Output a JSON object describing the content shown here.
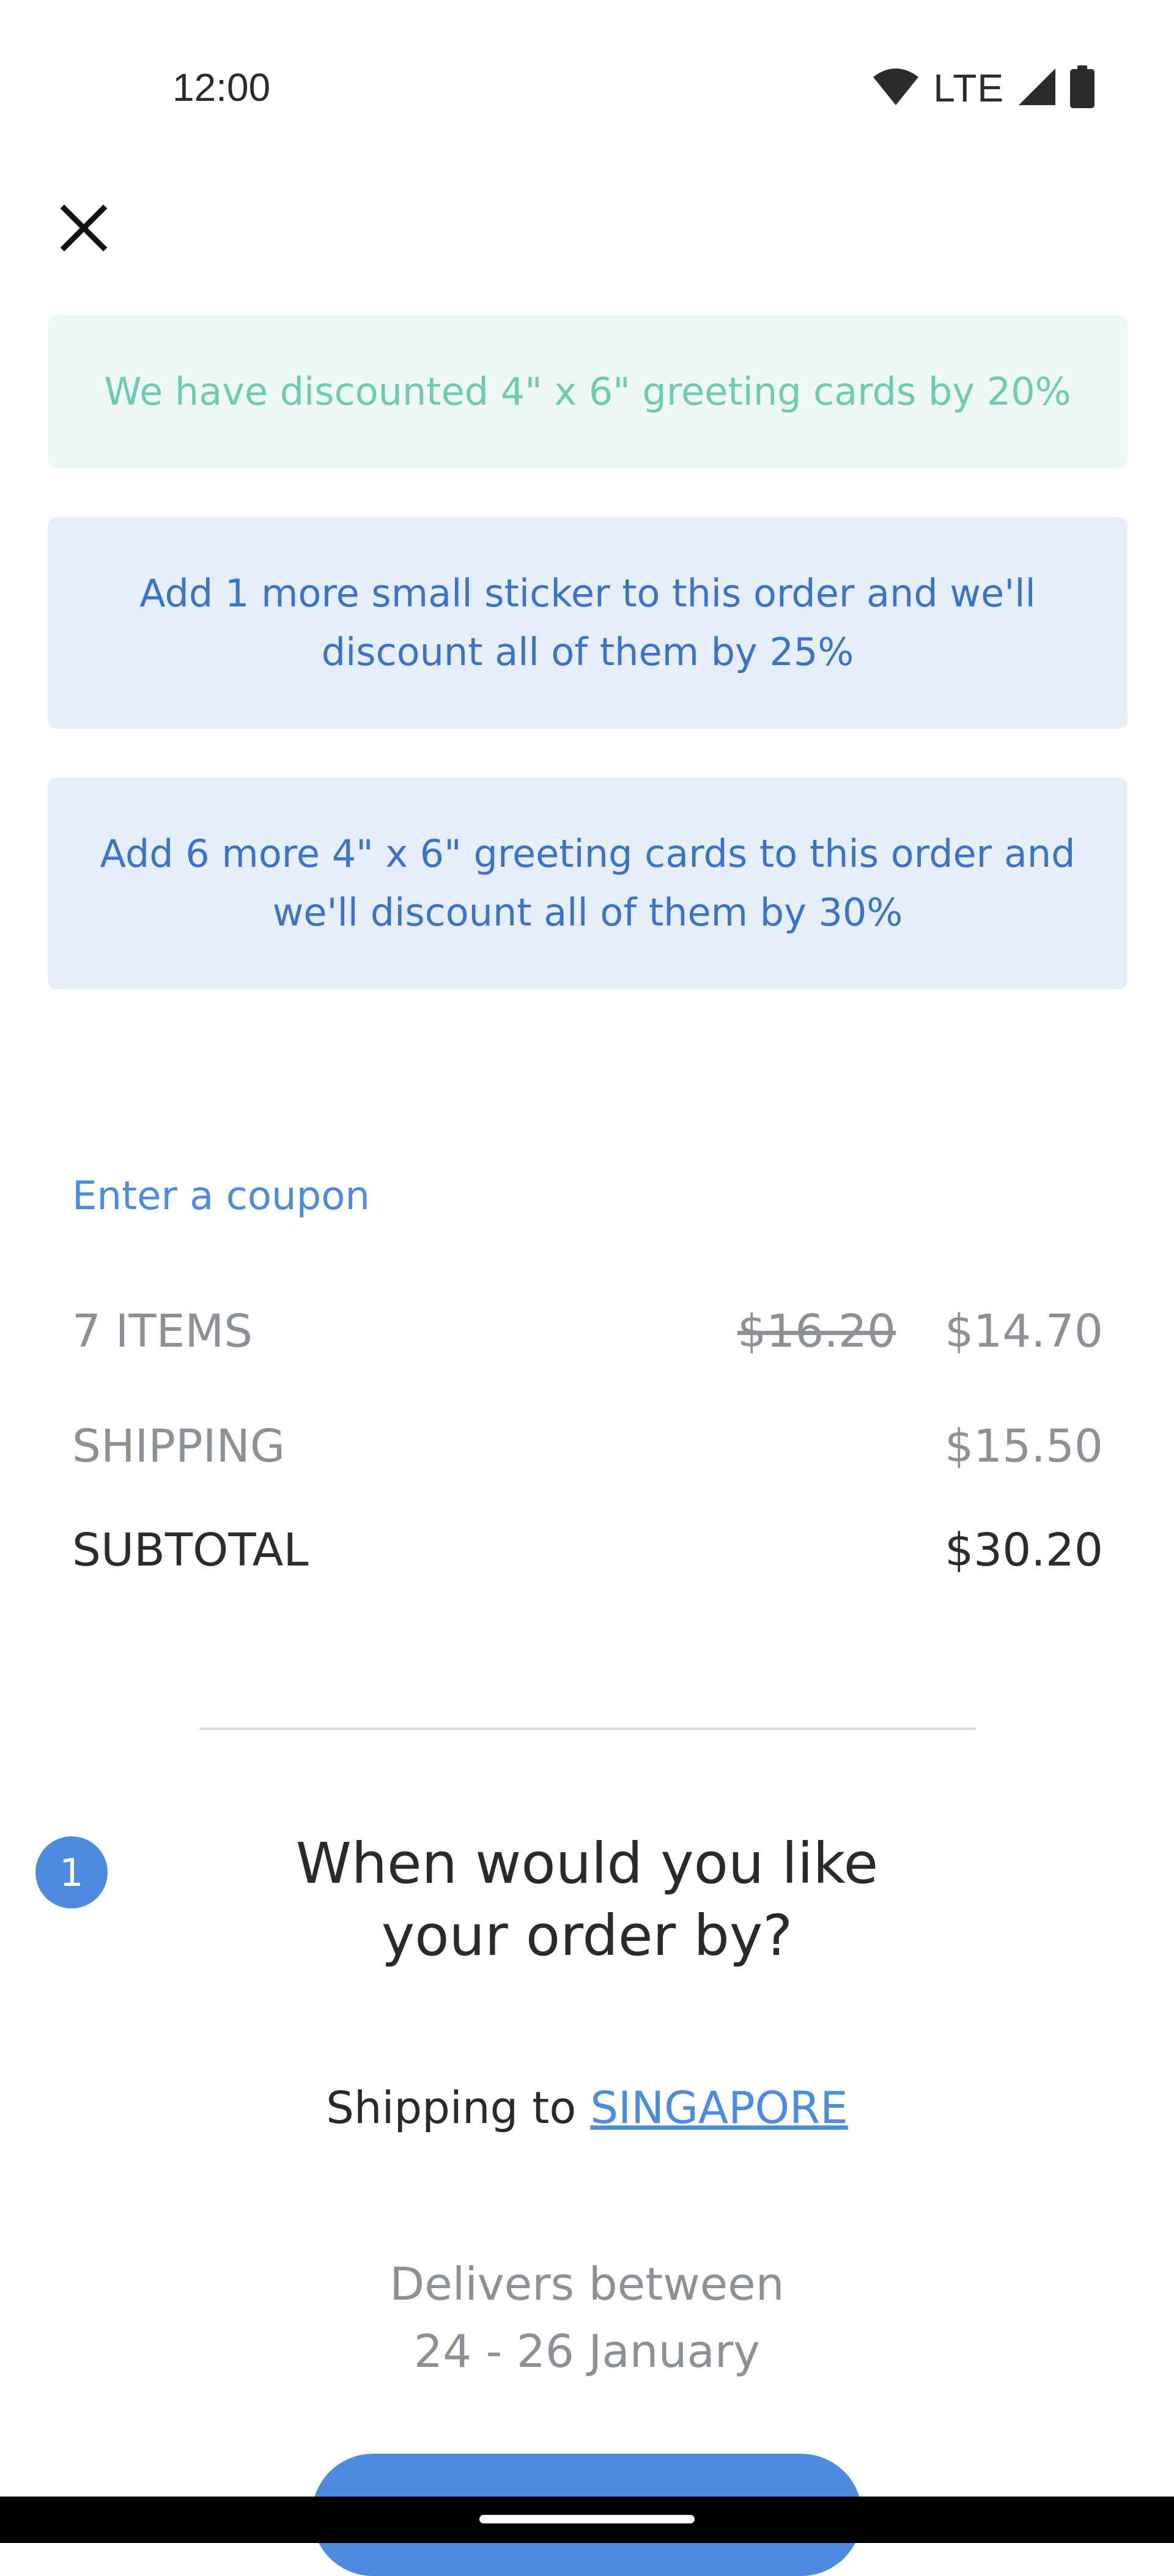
{
  "status_bar": {
    "time": "12:00",
    "network": "LTE",
    "icons": [
      "wifi-icon",
      "signal-icon",
      "battery-icon"
    ]
  },
  "header": {
    "close_icon": "close-icon"
  },
  "promotions": {
    "applied": {
      "text": "We have discounted 4\" x 6\" greeting cards by 20%",
      "color": "#6ccbb0",
      "background": "#eef8f5"
    },
    "offers": [
      {
        "line1": "Add 1 more small sticker to this order and we'll",
        "line2": "discount all of them by 25%"
      },
      {
        "line1": "Add 6 more 4\" x 6\" greeting cards to this order and",
        "line2": "we'll discount all of them by 30%"
      }
    ],
    "offer_color": "#3a73c7",
    "offer_background": "#e6eff9"
  },
  "coupon": {
    "label": "Enter a coupon"
  },
  "summary": {
    "items_label": "7 ITEMS",
    "items_original_price": "$16.20",
    "items_price": "$14.70",
    "shipping_label": "SHIPPING",
    "shipping_price": "$15.50",
    "subtotal_label": "SUBTOTAL",
    "subtotal_price": "$30.20"
  },
  "delivery_step": {
    "step_number": "1",
    "title_line1": "When would you like",
    "title_line2": "your order by?",
    "shipping_prefix": "Shipping to",
    "shipping_country": "SINGAPORE",
    "delivery_line1": "Delivers between",
    "delivery_line2": "24 - 26 January"
  },
  "colors": {
    "accent": "#4d8bdf",
    "muted_text": "#8c9196",
    "primary_text": "#2a2a2a"
  }
}
